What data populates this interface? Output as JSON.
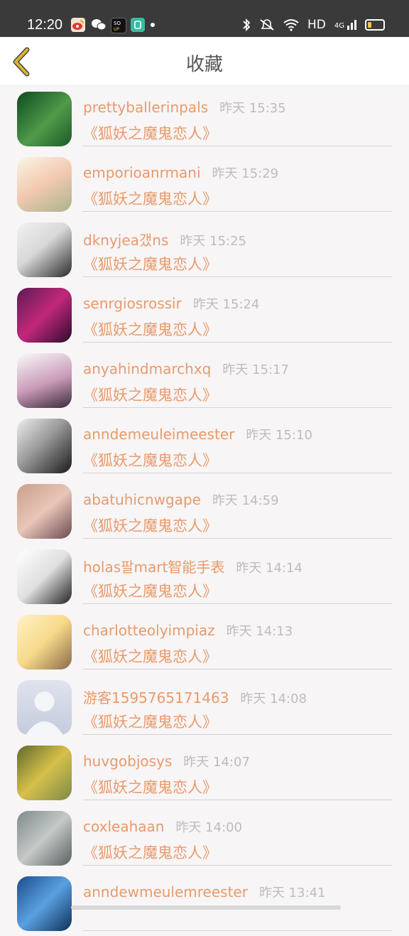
{
  "status": {
    "time": "12:20",
    "network": "HD",
    "signal": "4G",
    "icons": [
      "weibo-icon",
      "wechat-icon",
      "soul-app-icon",
      "green-app-icon",
      "bluetooth-icon",
      "mute-icon",
      "wifi-icon",
      "signal-icon",
      "battery-icon"
    ]
  },
  "header": {
    "title": "收藏"
  },
  "colors": {
    "accent": "#e89a6b",
    "time": "#bdbdbd",
    "back_icon": "#d8b435"
  },
  "items": [
    {
      "name": "prettyballerinpals",
      "time": "昨天 15:35",
      "book": "《狐妖之魔鬼恋人》"
    },
    {
      "name": "emporioanrmani",
      "time": "昨天 15:29",
      "book": "《狐妖之魔鬼恋人》"
    },
    {
      "name": "dknyjea갰ns",
      "time": "昨天 15:25",
      "book": "《狐妖之魔鬼恋人》"
    },
    {
      "name": "senrgiosrossir",
      "time": "昨天 15:24",
      "book": "《狐妖之魔鬼恋人》"
    },
    {
      "name": "anyahindmarchxq",
      "time": "昨天 15:17",
      "book": "《狐妖之魔鬼恋人》"
    },
    {
      "name": "anndemeuleimeester",
      "time": "昨天 15:10",
      "book": "《狐妖之魔鬼恋人》"
    },
    {
      "name": "abatuhicnwgape",
      "time": "昨天 14:59",
      "book": "《狐妖之魔鬼恋人》"
    },
    {
      "name": "holas팔mart智能手表",
      "time": "昨天 14:14",
      "book": "《狐妖之魔鬼恋人》"
    },
    {
      "name": "charlotteolyimpiaz",
      "time": "昨天 14:13",
      "book": "《狐妖之魔鬼恋人》"
    },
    {
      "name": "游客1595765171463",
      "time": "昨天 14:08",
      "book": "《狐妖之魔鬼恋人》"
    },
    {
      "name": "huvgobjosys",
      "time": "昨天 14:07",
      "book": "《狐妖之魔鬼恋人》"
    },
    {
      "name": "coxleahaan",
      "time": "昨天 14:00",
      "book": "《狐妖之魔鬼恋人》"
    },
    {
      "name": "anndewmeulemreester",
      "time": "昨天 13:41",
      "book": ""
    }
  ]
}
